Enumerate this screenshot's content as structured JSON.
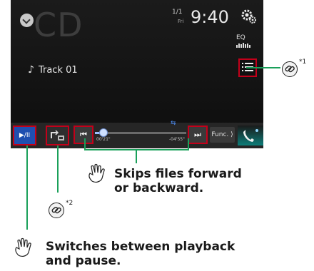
{
  "screen": {
    "source_title": "CD",
    "track_counter": "1/1",
    "day": "Fri",
    "clock": "9:40",
    "eq_label": "EQ",
    "track_label": "Track 01",
    "elapsed": "00'21\"",
    "remaining": "-04'55\"",
    "progress_fraction": 0.07,
    "func_label": "Func.",
    "play_label": "▶/II",
    "prev_label": "⏮",
    "next_label": "⏭"
  },
  "annotations": {
    "skip_text_line1": "Skips files forward",
    "skip_text_line2": "or backward.",
    "play_text_line1": "Switches between playback",
    "play_text_line2": "and pause.",
    "note1": "*1",
    "note2": "*2"
  },
  "colors": {
    "highlight_red": "#c3001a",
    "annotation_green": "#1aa05a",
    "play_blue": "#1f4fb0"
  },
  "icons": [
    "source-menu-icon",
    "settings-gear-icon",
    "eq-icon",
    "list-icon",
    "repeat-icon",
    "phone-icon",
    "hand-pointer-icon",
    "link-icon",
    "music-note-icon"
  ]
}
